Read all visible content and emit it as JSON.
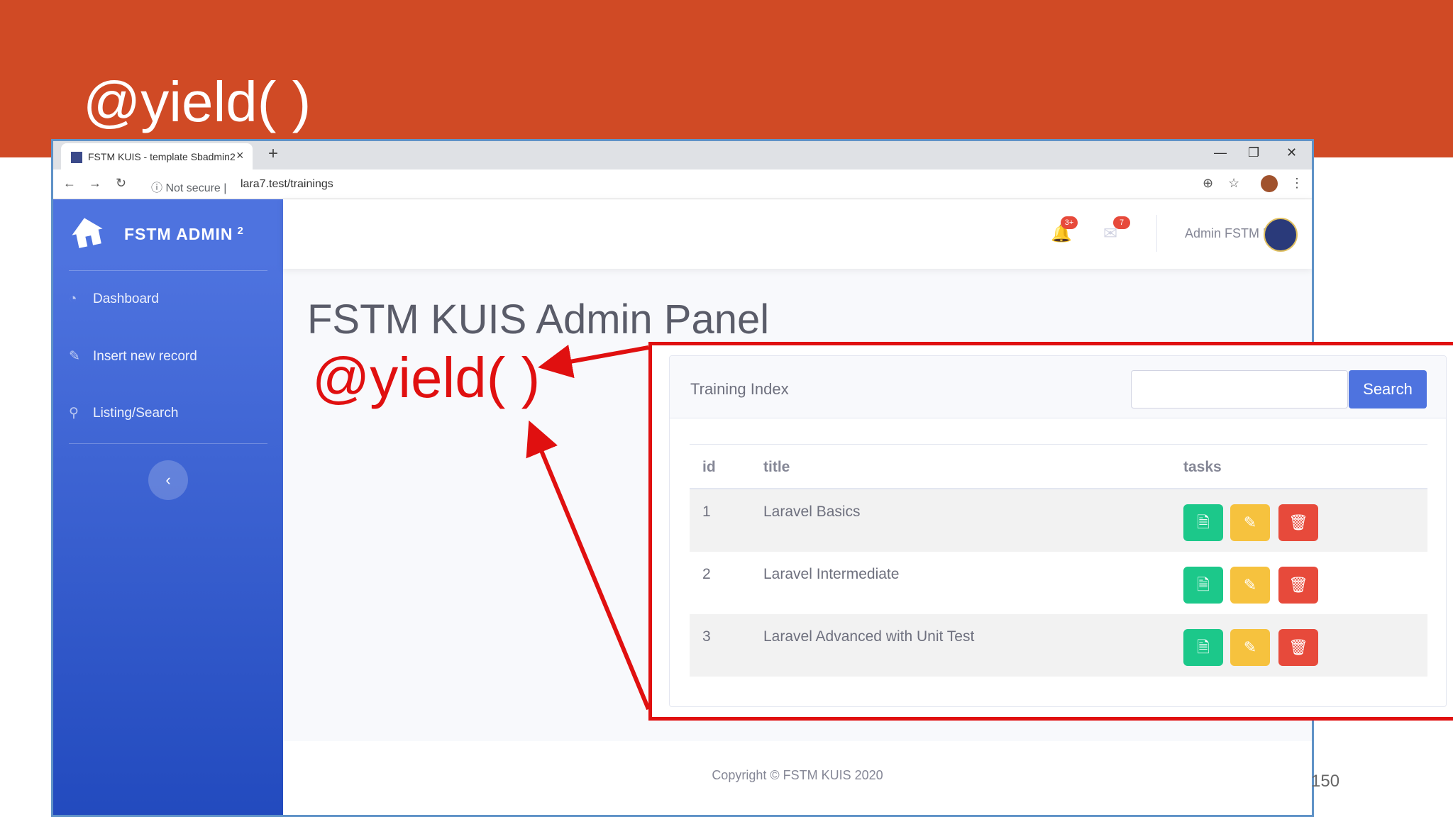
{
  "slide": {
    "title": "@yield( )",
    "page_number": "150",
    "band_color": "#d04a25"
  },
  "browser": {
    "tab_title": "FSTM KUIS - template Sbadmin2",
    "tab_close": "×",
    "new_tab": "+",
    "not_secure": "ⓘ  Not secure  |",
    "url": "lara7.test/trainings",
    "window_controls": [
      "—",
      "❐",
      "✕"
    ]
  },
  "sidebar": {
    "brand": "FSTM ADMIN",
    "brand_sup": "2",
    "items": [
      {
        "label": "Dashboard",
        "icon": "tachometer-icon",
        "glyph": "◔"
      },
      {
        "label": "Insert new record",
        "icon": "edit-icon",
        "glyph": "✎"
      },
      {
        "label": "Listing/Search",
        "icon": "search-icon",
        "glyph": "⚲"
      }
    ],
    "collapse_glyph": "‹",
    "accent": "#4e73df"
  },
  "topbar": {
    "alerts_badge": "3+",
    "messages_badge": "7",
    "user_name": "Admin FSTM KUIS"
  },
  "main": {
    "heading": "FSTM KUIS Admin Panel"
  },
  "annotation": {
    "label": "@yield( )",
    "color": "#e01010"
  },
  "card": {
    "title": "Training Index",
    "search_placeholder": "",
    "search_button": "Search",
    "columns": [
      "id",
      "title",
      "tasks"
    ],
    "rows": [
      {
        "id": "1",
        "title": "Laravel Basics"
      },
      {
        "id": "2",
        "title": "Laravel Intermediate"
      },
      {
        "id": "3",
        "title": "Laravel Advanced with Unit Test"
      }
    ],
    "action_glyphs": {
      "view": "🗎",
      "edit": "✎",
      "delete": "🗑"
    },
    "colors": {
      "view": "#1cc88a",
      "edit": "#f6c23e",
      "delete": "#e74a3b",
      "primary": "#4e73df"
    }
  },
  "footer": {
    "copyright": "Copyright © FSTM KUIS 2020"
  }
}
